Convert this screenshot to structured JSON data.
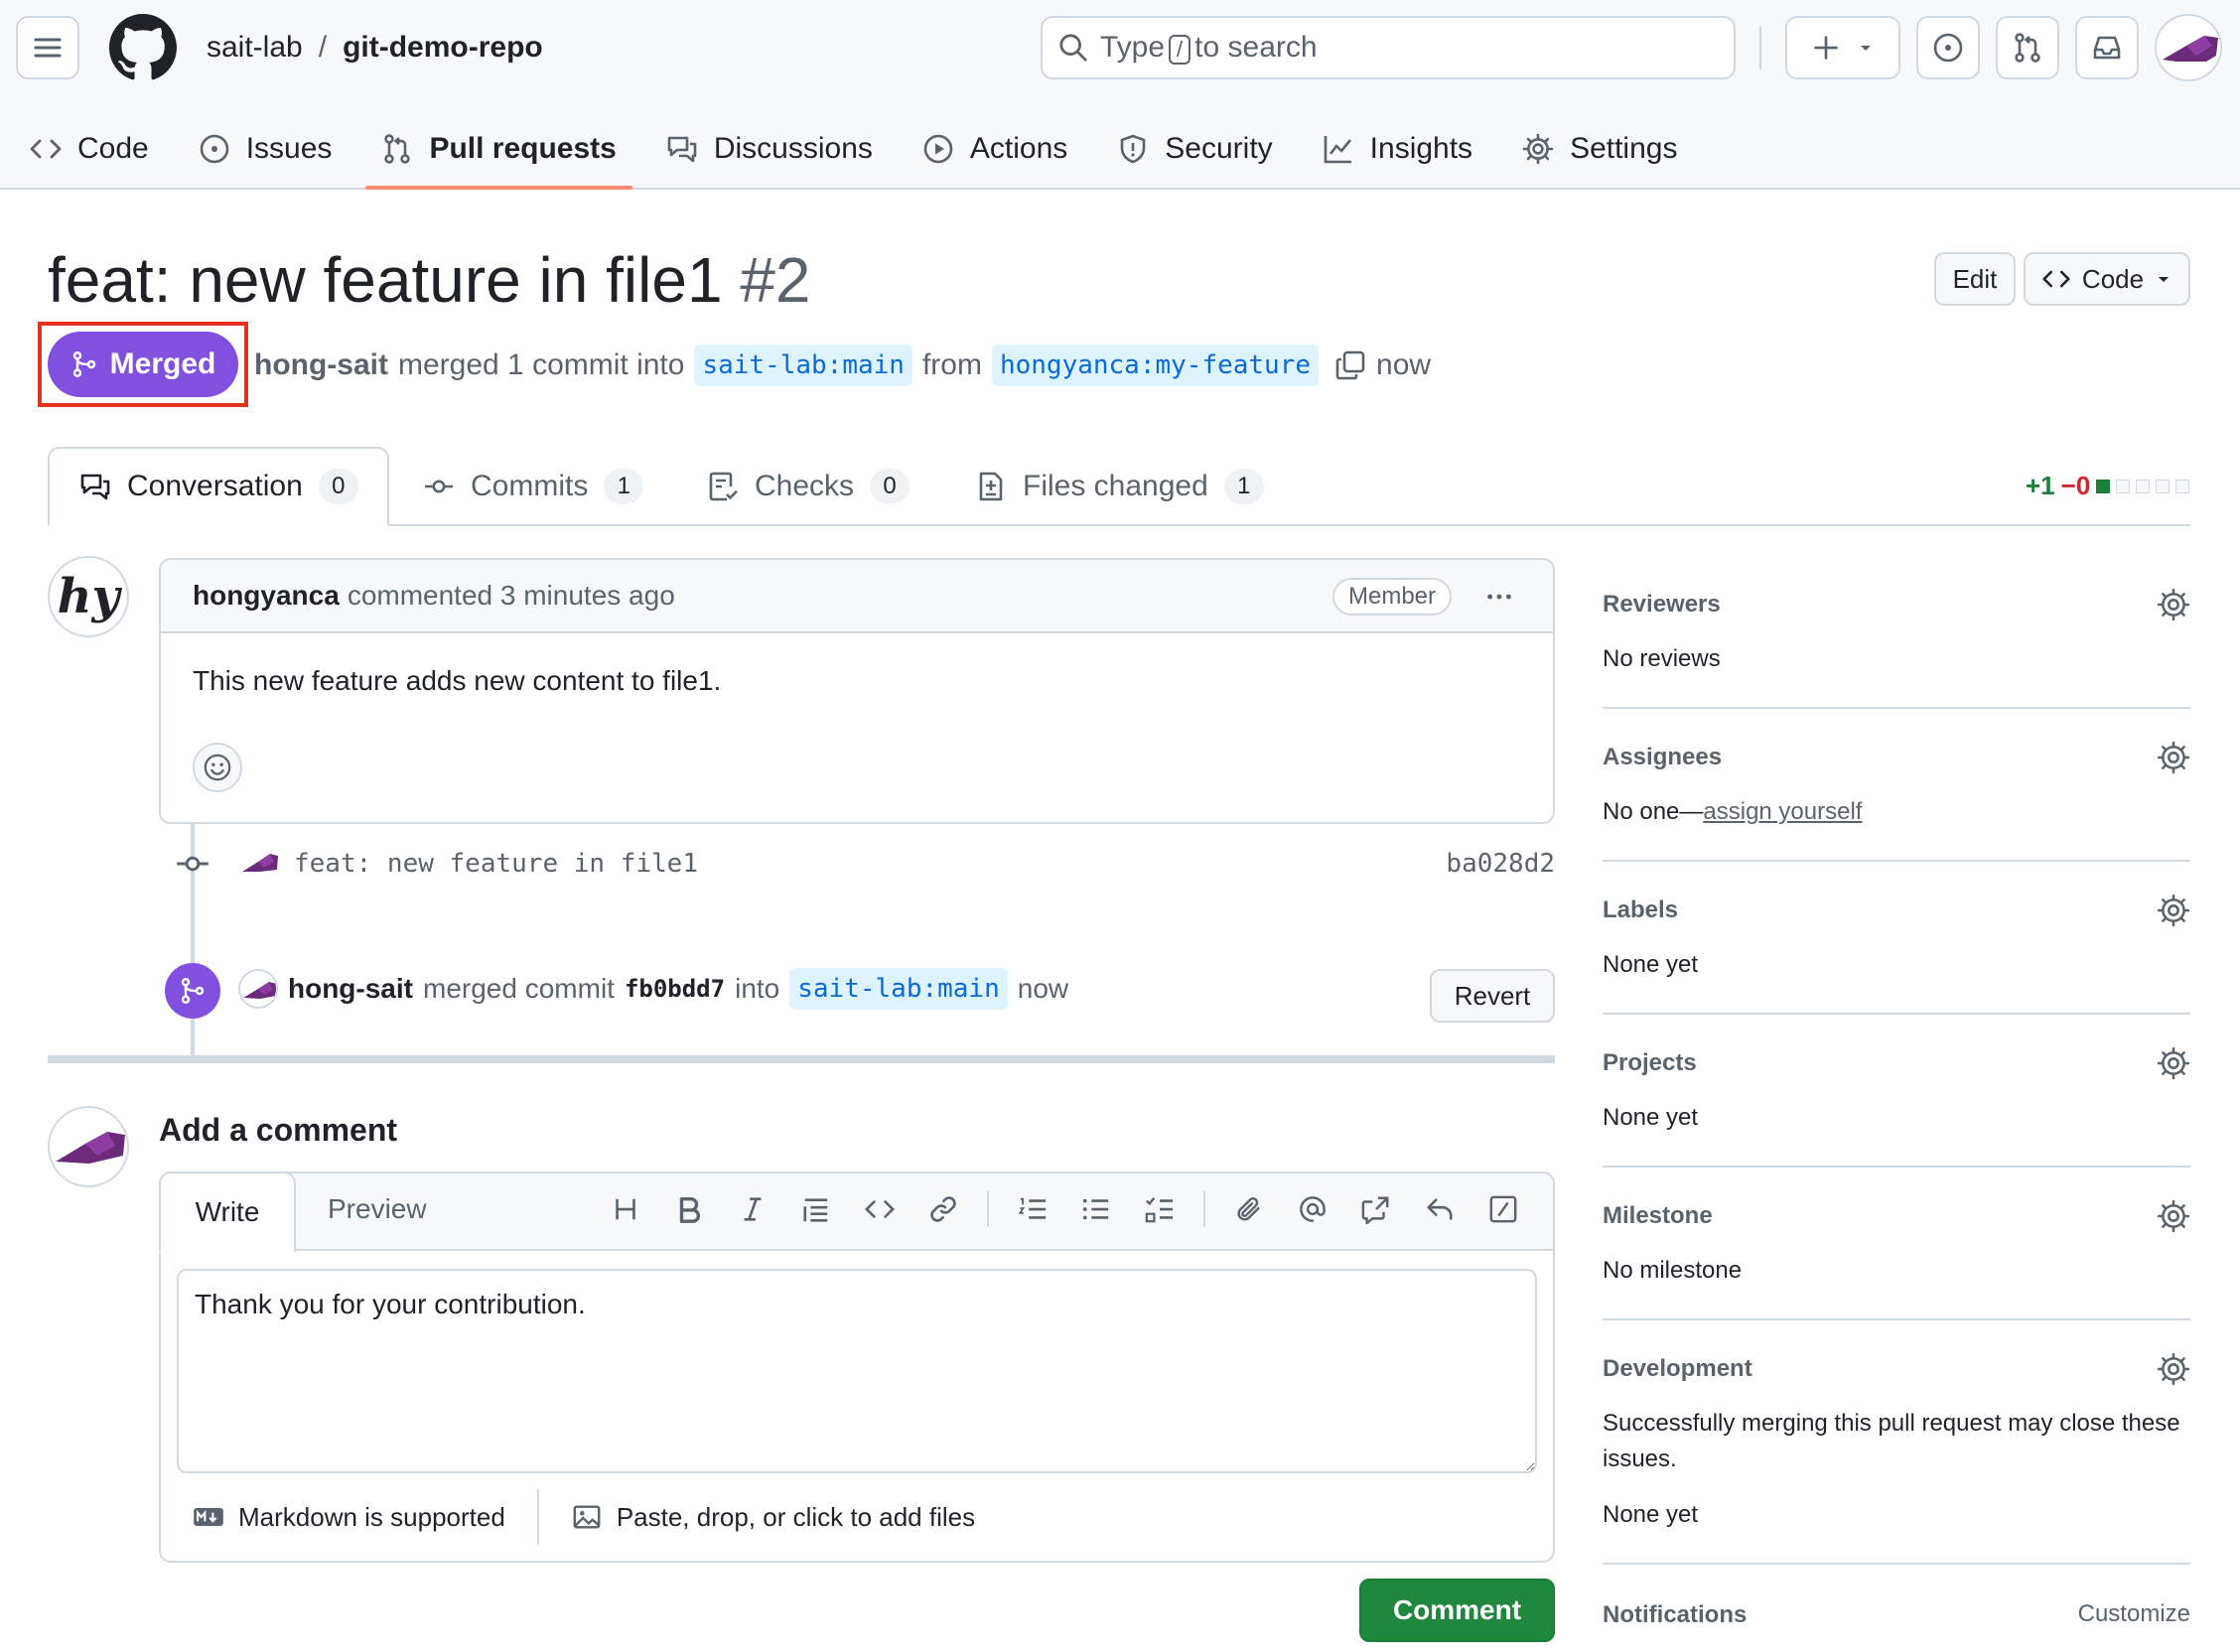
{
  "header": {
    "owner": "sait-lab",
    "separator": "/",
    "repo": "git-demo-repo",
    "search_prefix": "Type",
    "search_key": "/",
    "search_suffix": "to search"
  },
  "repo_nav": [
    {
      "label": "Code",
      "icon": "code-icon"
    },
    {
      "label": "Issues",
      "icon": "issue-icon"
    },
    {
      "label": "Pull requests",
      "icon": "pull-request-icon",
      "active": true
    },
    {
      "label": "Discussions",
      "icon": "discussion-icon"
    },
    {
      "label": "Actions",
      "icon": "play-icon"
    },
    {
      "label": "Security",
      "icon": "shield-icon"
    },
    {
      "label": "Insights",
      "icon": "graph-icon"
    },
    {
      "label": "Settings",
      "icon": "gear-icon"
    }
  ],
  "pr": {
    "title": "feat: new feature in file1",
    "number": "#2",
    "edit_label": "Edit",
    "code_label": "Code",
    "state": "Merged",
    "author": "hong-sait",
    "merged_text": "merged 1 commit into",
    "base_branch": "sait-lab:main",
    "from_text": "from",
    "head_branch": "hongyanca:my-feature",
    "time": "now"
  },
  "tabs": [
    {
      "label": "Conversation",
      "count": "0"
    },
    {
      "label": "Commits",
      "count": "1"
    },
    {
      "label": "Checks",
      "count": "0"
    },
    {
      "label": "Files changed",
      "count": "1"
    }
  ],
  "diffstat": {
    "additions": "+1",
    "deletions": "−0",
    "color_add": "#1a7f37",
    "color_del": "#d1242f"
  },
  "comment": {
    "avatar_text": "hy",
    "author": "hongyanca",
    "action": "commented 3 minutes ago",
    "role": "Member",
    "body": "This new feature adds new content to file1."
  },
  "commit": {
    "message": "feat: new feature in file1",
    "sha": "ba028d2"
  },
  "merge_event": {
    "author": "hong-sait",
    "text1": "merged commit",
    "commit": "fb0bdd7",
    "text2": "into",
    "branch": "sait-lab:main",
    "time": "now",
    "revert_label": "Revert"
  },
  "add_comment": {
    "title": "Add a comment",
    "write_tab": "Write",
    "preview_tab": "Preview",
    "text": "Thank you for your contribution.",
    "markdown_note": "Markdown is supported",
    "attach_note": "Paste, drop, or click to add files",
    "submit_label": "Comment"
  },
  "sidebar": {
    "reviewers": {
      "title": "Reviewers",
      "value": "No reviews"
    },
    "assignees": {
      "title": "Assignees",
      "value_prefix": "No one—",
      "value_link": "assign yourself"
    },
    "labels": {
      "title": "Labels",
      "value": "None yet"
    },
    "projects": {
      "title": "Projects",
      "value": "None yet"
    },
    "milestone": {
      "title": "Milestone",
      "value": "No milestone"
    },
    "development": {
      "title": "Development",
      "note": "Successfully merging this pull request may close these issues.",
      "value": "None yet"
    },
    "notifications": {
      "title": "Notifications",
      "action": "Customize"
    }
  },
  "colors": {
    "merged": "#8250df",
    "highlight": "#e5321f",
    "primary_button": "#1f883d",
    "active_tab_underline": "#fd8c73"
  }
}
